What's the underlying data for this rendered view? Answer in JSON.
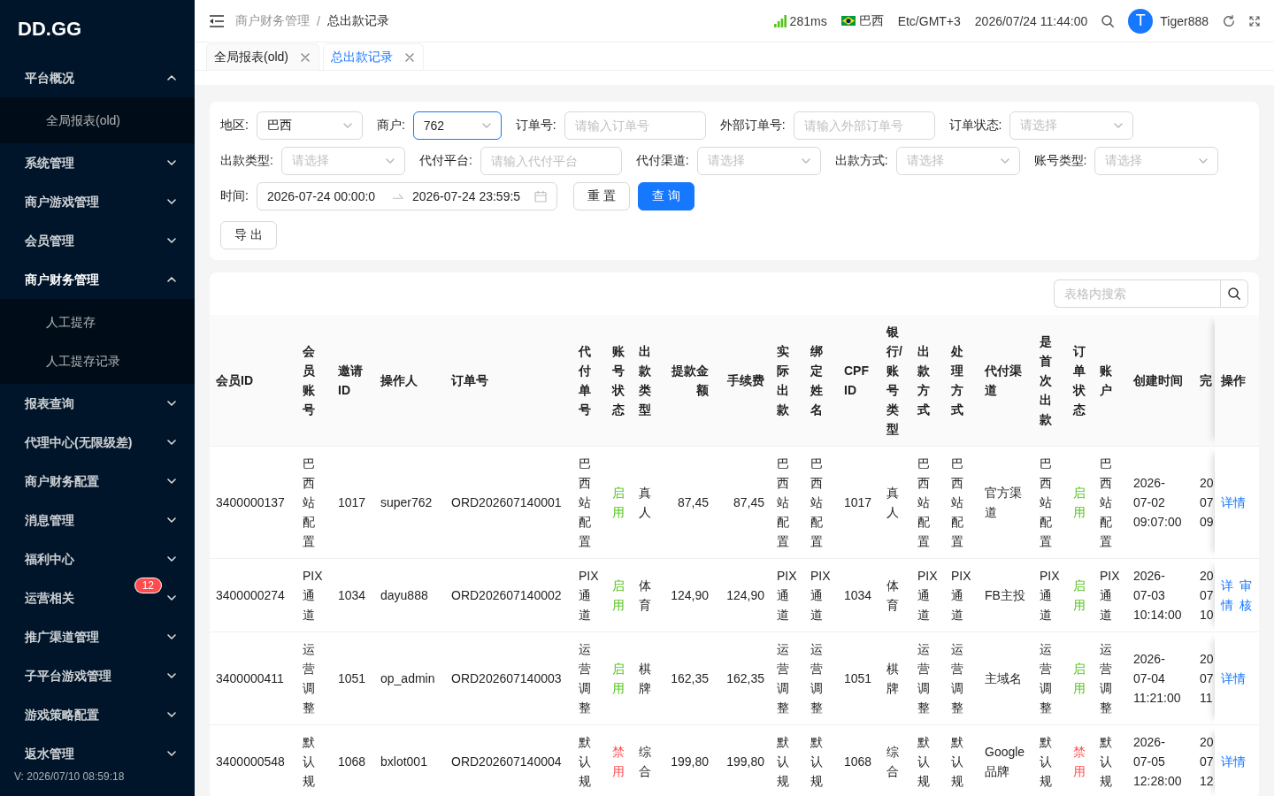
{
  "sidebar": {
    "logo": "DD.GG",
    "items": [
      {
        "label": "平台概况",
        "expanded": true,
        "selected": false,
        "children": [
          {
            "label": "全局报表(old)",
            "selected": false
          }
        ]
      },
      {
        "label": "系统管理",
        "expanded": false,
        "selected": false
      },
      {
        "label": "商户游戏管理",
        "expanded": false,
        "selected": false
      },
      {
        "label": "会员管理",
        "expanded": false,
        "selected": false
      },
      {
        "label": "商户财务管理",
        "expanded": true,
        "selected": true,
        "children": [
          {
            "label": "人工提存",
            "selected": false
          },
          {
            "label": "人工提存记录",
            "selected": false
          }
        ]
      },
      {
        "label": "报表查询",
        "expanded": false,
        "selected": false
      },
      {
        "label": "代理中心(无限级差)",
        "expanded": false,
        "selected": false
      },
      {
        "label": "商户财务配置",
        "expanded": false,
        "selected": false
      },
      {
        "label": "消息管理",
        "expanded": false,
        "selected": false
      },
      {
        "label": "福利中心",
        "expanded": false,
        "selected": false
      },
      {
        "label": "运营相关",
        "expanded": false,
        "selected": false,
        "badge": "12"
      },
      {
        "label": "推广渠道管理",
        "expanded": false,
        "selected": false
      },
      {
        "label": "子平台游戏管理",
        "expanded": false,
        "selected": false
      },
      {
        "label": "游戏策略配置",
        "expanded": false,
        "selected": false
      },
      {
        "label": "返水管理",
        "expanded": false,
        "selected": false
      }
    ],
    "version": "V: 2026/07/10 08:59:18"
  },
  "header": {
    "breadcrumb": [
      "商户财务管理",
      "总出款记录"
    ],
    "breadcrumb_separator": "/",
    "latency": "281ms",
    "region": "巴西",
    "timezone": "Etc/GMT+3",
    "datetime": "2026/07/24 11:44:00",
    "avatar_letter": "T",
    "username": "Tiger888"
  },
  "tabs": [
    {
      "label": "全局报表(old)",
      "selected": false
    },
    {
      "label": "总出款记录",
      "selected": true
    }
  ],
  "filters": {
    "fields": [
      {
        "label": "地区:",
        "kind": "select",
        "value": "巴西",
        "focused": false
      },
      {
        "label": "商户:",
        "kind": "select",
        "value": "762",
        "focused": true
      },
      {
        "label": "订单号:",
        "kind": "input",
        "placeholder": "请输入订单号",
        "focused": false
      },
      {
        "label": "外部订单号:",
        "kind": "input",
        "placeholder": "请输入外部订单号",
        "focused": false
      },
      {
        "label": "订单状态:",
        "kind": "select",
        "placeholder": "请选择",
        "focused": false
      },
      {
        "label": "出款类型:",
        "kind": "select",
        "placeholder": "请选择",
        "focused": false
      },
      {
        "label": "代付平台:",
        "kind": "input",
        "placeholder": "请输入代付平台",
        "focused": false
      },
      {
        "label": "代付渠道:",
        "kind": "select",
        "placeholder": "请选择",
        "focused": false
      },
      {
        "label": "出款方式:",
        "kind": "select",
        "placeholder": "请选择",
        "focused": false
      },
      {
        "label": "账号类型:",
        "kind": "select",
        "placeholder": "请选择",
        "focused": false
      },
      {
        "label": "时间:",
        "kind": "date-range",
        "start": "2026-07-24 00:00:0",
        "end": "2026-07-24 23:59:5",
        "focused": false
      }
    ],
    "buttons": [
      {
        "label": "重 置",
        "kind": "default"
      },
      {
        "label": "查 询",
        "kind": "primary"
      }
    ],
    "export_button": "导 出"
  },
  "table": {
    "search_placeholder": "表格内搜索",
    "columns": [
      {
        "label": "会员ID",
        "kind": "text"
      },
      {
        "label": "会员账号",
        "kind": "text"
      },
      {
        "label": "邀请ID",
        "kind": "text"
      },
      {
        "label": "操作人",
        "kind": "text"
      },
      {
        "label": "订单号",
        "kind": "text"
      },
      {
        "label": "代付单号",
        "kind": "text"
      },
      {
        "label": "账号状态",
        "kind": "status"
      },
      {
        "label": "出款类型",
        "kind": "text"
      },
      {
        "label": "提款金额",
        "kind": "amount"
      },
      {
        "label": "手续费",
        "kind": "amount"
      },
      {
        "label": "实际出款",
        "kind": "text"
      },
      {
        "label": "绑定姓名",
        "kind": "text"
      },
      {
        "label": "CPF ID",
        "kind": "text"
      },
      {
        "label": "银行/账号类型",
        "kind": "text"
      },
      {
        "label": "出款方式",
        "kind": "text"
      },
      {
        "label": "处理方式",
        "kind": "text"
      },
      {
        "label": "代付渠道",
        "kind": "text"
      },
      {
        "label": "是首次出款",
        "kind": "text"
      },
      {
        "label": "订单状态",
        "kind": "status"
      },
      {
        "label": "账户",
        "kind": "text"
      },
      {
        "label": "创建时间",
        "kind": "datetime"
      },
      {
        "label": "完",
        "kind": "text"
      },
      {
        "label": "操作",
        "kind": "actions"
      }
    ],
    "rows": [
      {
        "cells": [
          "3400000137",
          "巴西站配置",
          "1017",
          "super762",
          "ORD202607140001",
          "巴西站配置",
          {
            "text": "启用",
            "color": "#52c41a"
          },
          "真人",
          "87,45",
          "87,45",
          "巴西站配置",
          "巴西站配置",
          "1017",
          "真人",
          "巴西站配置",
          "巴西站配置",
          "官方渠道",
          "巴西站配置",
          {
            "text": "启用",
            "color": "#52c41a"
          },
          "巴西站配置",
          "2026-07-02 09:07:00",
          "20 07 09",
          [
            "详情"
          ]
        ]
      },
      {
        "cells": [
          "3400000274",
          "PIX通道",
          "1034",
          "dayu888",
          "ORD202607140002",
          "PIX通道",
          {
            "text": "启用",
            "color": "#52c41a"
          },
          "体育",
          "124,90",
          "124,90",
          "PIX通道",
          "PIX通道",
          "1034",
          "体育",
          "PIX通道",
          "PIX通道",
          "FB主投",
          "PIX通道",
          {
            "text": "启用",
            "color": "#52c41a"
          },
          "PIX通道",
          "2026-07-03 10:14:00",
          "20 07 10",
          [
            "详情",
            "审核"
          ]
        ]
      },
      {
        "cells": [
          "3400000411",
          "运营调整",
          "1051",
          "op_admin",
          "ORD202607140003",
          "运营调整",
          {
            "text": "启用",
            "color": "#52c41a"
          },
          "棋牌",
          "162,35",
          "162,35",
          "运营调整",
          "运营调整",
          "1051",
          "棋牌",
          "运营调整",
          "运营调整",
          "主域名",
          "运营调整",
          {
            "text": "启用",
            "color": "#52c41a"
          },
          "运营调整",
          "2026-07-04 11:21:00",
          "20 07 11",
          [
            "详情"
          ]
        ]
      },
      {
        "cells": [
          "3400000548",
          "默认规",
          "1068",
          "bxlot001",
          "ORD202607140004",
          "默认规",
          {
            "text": "禁用",
            "color": "#ff4d4f"
          },
          "综合",
          "199,80",
          "199,80",
          "默认规",
          "默认规",
          "1068",
          "综合",
          "默认规",
          "默认规",
          "Google品牌",
          "默认规",
          {
            "text": "禁用",
            "color": "#ff4d4f"
          },
          "默认规",
          "2026-07-05 12:28:00",
          "20 07 12",
          [
            "详情"
          ]
        ]
      }
    ]
  }
}
